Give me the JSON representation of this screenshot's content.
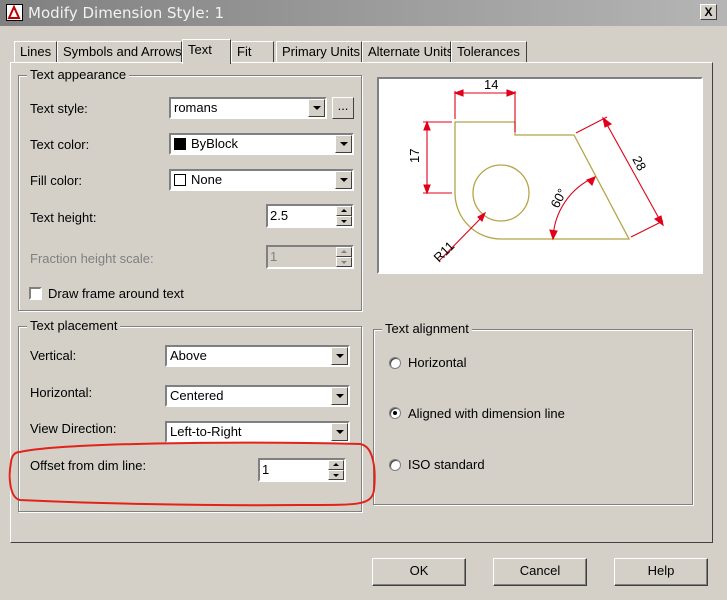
{
  "window": {
    "title": "Modify Dimension Style: 1",
    "close_glyph": "X"
  },
  "tabs": [
    "Lines",
    "Symbols and Arrows",
    "Text",
    "Fit",
    "Primary Units",
    "Alternate Units",
    "Tolerances"
  ],
  "active_tab": "Text",
  "text_appearance": {
    "title": "Text appearance",
    "text_style_label": "Text style:",
    "text_style_value": "romans",
    "browse_label": "...",
    "text_color_label": "Text color:",
    "text_color_value": "ByBlock",
    "fill_color_label": "Fill color:",
    "fill_color_value": "None",
    "text_height_label": "Text height:",
    "text_height_value": "2.5",
    "fraction_height_label": "Fraction height scale:",
    "fraction_height_value": "1",
    "draw_frame_label": "Draw frame around text",
    "draw_frame_checked": false
  },
  "text_placement": {
    "title": "Text placement",
    "vertical_label": "Vertical:",
    "vertical_value": "Above",
    "horizontal_label": "Horizontal:",
    "horizontal_value": "Centered",
    "view_direction_label": "View Direction:",
    "view_direction_value": "Left-to-Right",
    "offset_label": "Offset from dim line:",
    "offset_value": "1"
  },
  "text_alignment": {
    "title": "Text alignment",
    "options": [
      "Horizontal",
      "Aligned with dimension line",
      "ISO standard"
    ],
    "selected": "Aligned with dimension line"
  },
  "preview": {
    "dim_top": "14",
    "dim_left": "17",
    "dim_diag": "28",
    "dim_angle": "60°",
    "dim_radius": "R11"
  },
  "buttons": {
    "ok": "OK",
    "cancel": "Cancel",
    "help": "Help"
  },
  "colors": {
    "preview_geometry": "#b5a547",
    "preview_dimension": "#e0001a",
    "annotation": "#e2231a"
  }
}
